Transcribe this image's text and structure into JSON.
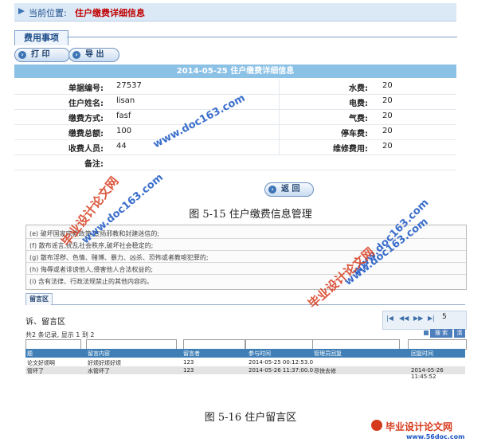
{
  "breadcrumb": {
    "prefix": "当前位置:",
    "current": "住户缴费详细信息"
  },
  "section_tab": "费用事项",
  "buttons": {
    "print": "打 印",
    "export": "导 出",
    "back": "返 回"
  },
  "detail": {
    "title": "2014-05-25 住户缴费详细信息",
    "rows": [
      {
        "label": "单据编号:",
        "value": "27537",
        "right_label": "水费:",
        "right_value": "20"
      },
      {
        "label": "住户姓名:",
        "value": "lisan",
        "right_label": "电费:",
        "right_value": "20"
      },
      {
        "label": "缴费方式:",
        "value": "fasf",
        "right_label": "气费:",
        "right_value": "20"
      },
      {
        "label": "缴费总额:",
        "value": "100",
        "right_label": "停车费:",
        "right_value": "20"
      },
      {
        "label": "收费人员:",
        "value": "44",
        "right_label": "维修费用:",
        "right_value": "20"
      },
      {
        "label": "备注:",
        "value": "",
        "right_label": "",
        "right_value": ""
      }
    ]
  },
  "fig1_caption": "图 5-15  住户缴费信息管理",
  "notices": [
    "(e) 破坏国家宗教政策,宣扬邪教和封建迷信的;",
    "(f) 散布谣言,扰乱社会秩序,破坏社会稳定的;",
    "(g) 散布淫秽、色情、赌博、暴力、凶杀、恐怖或者教唆犯罪的;",
    "(h) 侮辱或者诽谤他人,侵害他人合法权益的;",
    "(i) 含有法律、行政法规禁止的其他内容的。"
  ],
  "msg_tab": "留言区",
  "msg_title": "诉、留言区",
  "pager": {
    "page": "5"
  },
  "record_info": "共2 条记录, 显示 1 到 2",
  "search_label": "搜 索",
  "search_label2": "清",
  "grid": {
    "headers": [
      "题",
      "留言内容",
      "留言者",
      "参与时间",
      "管理员回复",
      "回复时间"
    ],
    "rows": [
      [
        "论文好烦啊",
        "好烦好烦好烦",
        "123",
        "2014-05-25 00:12:53.0",
        "",
        ""
      ],
      [
        "管坏了",
        "水管坏了",
        "123",
        "2014-05-26 11:37:00.0",
        "尽快去修",
        "2014-05-26 11:45:52"
      ]
    ]
  },
  "fig2_caption": "图 5-16  住户留言区",
  "watermarks": {
    "site_cn": "毕业设计论文网",
    "site_url": "www.doc163.com"
  },
  "brand": {
    "name": "毕业设计论文网",
    "url": "www.56doc.com"
  },
  "colors": {
    "title_bar": "#8cc1e6",
    "accent": "#1d4d8a",
    "crumb_red": "#c00000",
    "grid_header": "#3f7fb6"
  }
}
